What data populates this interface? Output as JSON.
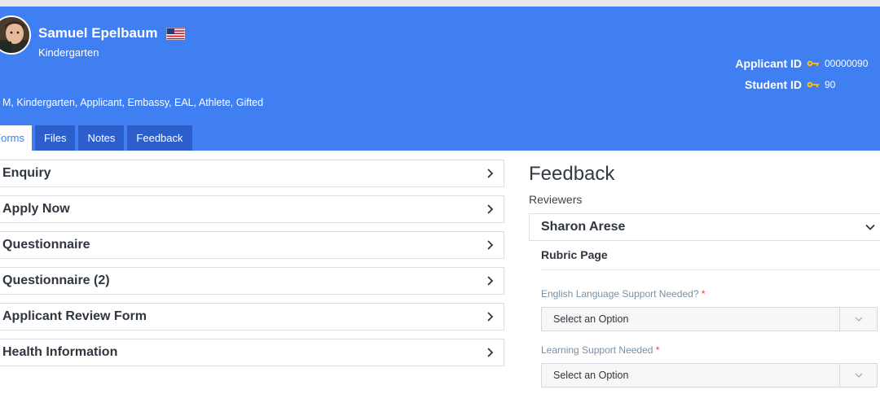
{
  "profile": {
    "name": "Samuel Epelbaum",
    "grade": "Kindergarten",
    "tags": "M, Kindergarten, Applicant,  Embassy,  EAL,  Athlete,  Gifted",
    "applicant_id_label": "Applicant ID",
    "applicant_id": "00000090",
    "student_id_label": "Student ID",
    "student_id": "90"
  },
  "tabs": [
    {
      "label": "Forms",
      "active": true
    },
    {
      "label": "Files",
      "active": false
    },
    {
      "label": "Notes",
      "active": false
    },
    {
      "label": "Feedback",
      "active": false
    }
  ],
  "forms": [
    {
      "label": "Enquiry"
    },
    {
      "label": "Apply Now"
    },
    {
      "label": "Questionnaire"
    },
    {
      "label": "Questionnaire (2)"
    },
    {
      "label": "Applicant Review Form"
    },
    {
      "label": "Health Information"
    }
  ],
  "feedback": {
    "title": "Feedback",
    "reviewers_label": "Reviewers",
    "reviewer": "Sharon Arese",
    "rubric": "Rubric Page",
    "questions": [
      {
        "label": "English Language Support Needed?",
        "required": "*",
        "value": "Select an Option"
      },
      {
        "label": "Learning Support Needed",
        "required": "*",
        "value": "Select an Option"
      }
    ]
  },
  "colors": {
    "brand": "#3f7ff2",
    "tab": "#2c5fcb",
    "key": "#f5b81c",
    "required": "#e0463a"
  },
  "icons": [
    "avatar-photo",
    "us-flag-icon",
    "key-icon",
    "chevron-right-icon",
    "chevron-down-icon"
  ]
}
